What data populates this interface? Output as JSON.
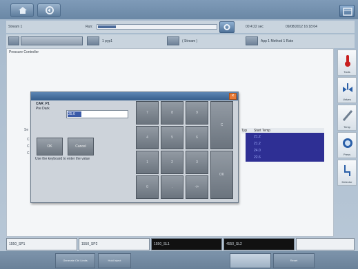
{
  "header": {
    "stream_label": "Stream 1",
    "run_label": "Run:",
    "progress": 0.15,
    "time_readout": "00:4:22 sec",
    "date_time": "09/08/2012 16:18:04"
  },
  "status_row": {
    "value_1": "1 pyp1",
    "value_2": "( Stream )",
    "value_3": "App 1 Method 1 Rate"
  },
  "main": {
    "title": "Pressure Controller"
  },
  "background_table": {
    "header": "Start Temp",
    "col0": "Typ",
    "rows": [
      "21.2",
      "21.2",
      "24.0",
      "22.6"
    ]
  },
  "left_labels": [
    "Se",
    "C",
    "C",
    "C"
  ],
  "dialog": {
    "name": "CAR_P1",
    "current_label": "Pre Dark",
    "value": "25.0",
    "ok_label": "OK",
    "cancel_label": "Cancel",
    "hint": "Use the keyboard to enter the value",
    "keys": [
      "7",
      "8",
      "9",
      "C",
      "4",
      "5",
      "6",
      "1",
      "2",
      "3",
      "0",
      ".",
      "-/+",
      "OK"
    ]
  },
  "side_tools": [
    {
      "name": "Tools",
      "icon": "thermometer-icon",
      "color": "#c81e1e"
    },
    {
      "name": "Valves",
      "icon": "valve-icon",
      "color": "#2a5fa8"
    },
    {
      "name": "Temp",
      "icon": "pencil-icon",
      "color": "#6f7f91"
    },
    {
      "name": "Press",
      "icon": "gauge-icon",
      "color": "#2a5fa8"
    },
    {
      "name": "Detector",
      "icon": "flow-icon",
      "color": "#2a5fa8"
    }
  ],
  "bottom_row": [
    "1550_SP1",
    "1550_SP2",
    "1550_SL1",
    "4550_SL2",
    ""
  ],
  "bottom_buttons": [
    "Generate Ctrl Limits",
    "Hold Inject",
    "",
    "Reset"
  ]
}
